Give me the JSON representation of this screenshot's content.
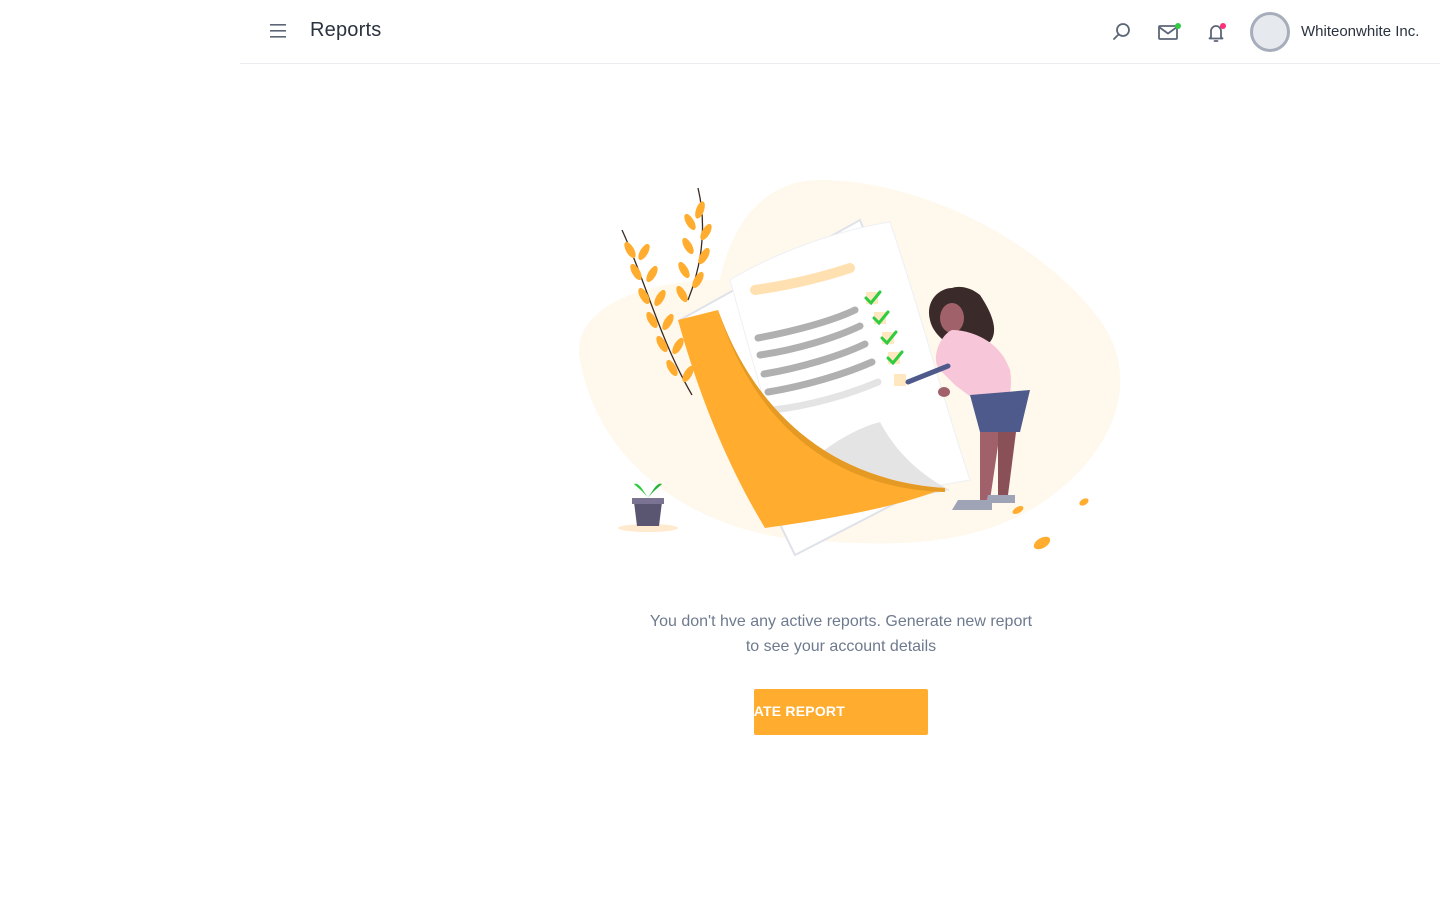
{
  "header": {
    "title": "Reports",
    "account_name": "Whiteonwhite Inc.",
    "icons": {
      "menu": "hamburger-icon",
      "search": "search-icon",
      "mail": "mail-icon",
      "notifications": "bell-icon"
    },
    "badges": {
      "mail_dot_color": "#2ecc40",
      "bell_dot_color": "#ff2d7a"
    }
  },
  "empty_state": {
    "message_line1": "You don't hve any active reports. Generate new report",
    "message_line2": "to see your account details",
    "button_label": "GENERATE REPORT"
  },
  "colors": {
    "accent": "#ffac2f",
    "text_muted": "#6e7a8e"
  }
}
